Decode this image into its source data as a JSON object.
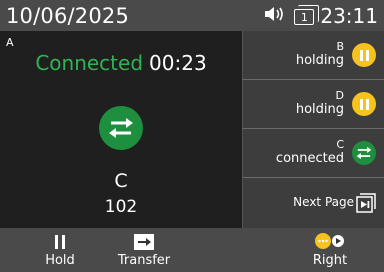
{
  "status_bar": {
    "date": "10/06/2025",
    "time": "23:11",
    "line_number": "1",
    "icons": [
      "ringer-icon",
      "line-key-icon"
    ]
  },
  "active_call": {
    "line_tag": "A",
    "status": "Connected",
    "timer": "00:23",
    "name": "C",
    "number": "102",
    "icon": "transfer-arrows-icon",
    "status_color": "#2fb353"
  },
  "side_calls": [
    {
      "name": "B",
      "state": "holding",
      "icon": "pause-icon",
      "color": "#f6c21c"
    },
    {
      "name": "D",
      "state": "holding",
      "icon": "pause-icon",
      "color": "#f6c21c"
    },
    {
      "name": "C",
      "state": "connected",
      "icon": "transfer-arrows-icon",
      "color": "#1d8f3e"
    }
  ],
  "next_page": {
    "label": "Next Page",
    "icon": "next-page-icon"
  },
  "softkeys": [
    {
      "label": "Hold",
      "icon": "pause-icon"
    },
    {
      "label": "Transfer",
      "icon": "transfer-icon"
    },
    {
      "label": "Right",
      "icon": "more-icon"
    }
  ]
}
